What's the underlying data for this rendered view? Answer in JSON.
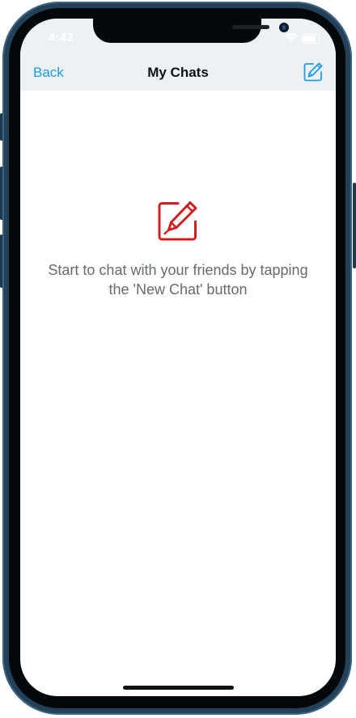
{
  "status_bar": {
    "time": "4:42"
  },
  "nav": {
    "back_label": "Back",
    "title": "My Chats",
    "compose_icon": "compose-icon"
  },
  "empty_state": {
    "icon": "compose-icon",
    "message": "Start to chat with your friends by tapping the 'New Chat' button"
  },
  "colors": {
    "accent": "#1f9be4",
    "empty_icon": "#d11f1f",
    "nav_background": "#eef1f4",
    "message_text": "#666b70"
  }
}
